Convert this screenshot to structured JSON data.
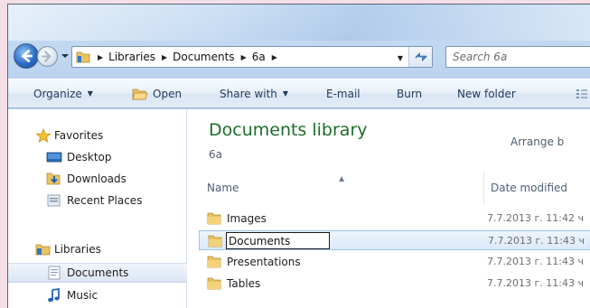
{
  "address": {
    "breadcrumbs": [
      "Libraries",
      "Documents",
      "6a"
    ],
    "search_placeholder": "Search 6a"
  },
  "toolbar": {
    "organize": "Organize",
    "open": "Open",
    "share_with": "Share with",
    "email": "E-mail",
    "burn": "Burn",
    "new_folder": "New folder"
  },
  "nav": {
    "favorites": "Favorites",
    "desktop": "Desktop",
    "downloads": "Downloads",
    "recent_places": "Recent Places",
    "libraries": "Libraries",
    "documents": "Documents",
    "music": "Music"
  },
  "library": {
    "title": "Documents library",
    "subtitle": "6a",
    "arrange_by": "Arrange b"
  },
  "columns": {
    "name": "Name",
    "date_modified": "Date modified"
  },
  "files": [
    {
      "name": "Images",
      "date": "7.7.2013 г. 11:42 ч"
    },
    {
      "name": "Documents",
      "date": "7.7.2013 г. 11:43 ч",
      "renaming": true
    },
    {
      "name": "Presentations",
      "date": "7.7.2013 г. 11:43 ч"
    },
    {
      "name": "Tables",
      "date": "7.7.2013 г. 11:43 ч"
    }
  ],
  "colors": {
    "title_green": "#1e6e2a",
    "toolbar_text": "#1e395b",
    "selection_border": "#9cc3ec"
  }
}
